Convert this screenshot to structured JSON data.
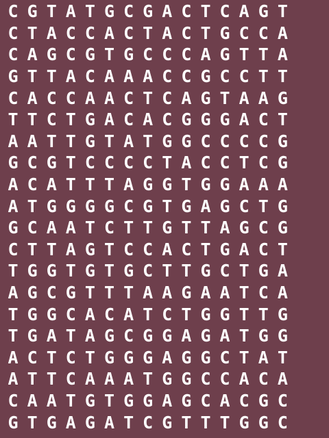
{
  "background_color": "#6e3f4c",
  "text_color": "#ffffff",
  "rows": [
    "CGTATGCGACTCAGT",
    "CTACCACTACTGCCA",
    "CAGCGTGCCCAGTTA",
    "GTTACAAACCGCCTT",
    "CACCAACTCAGTAAG",
    "TTCTGACACGGGACT",
    "AATTGTATGGCCCCG",
    "GCGTCCCCTACCTCG",
    "ACATTTAGGTGGAAA",
    "ATGGGGCGTGAGCTG",
    "GCAATCTTGTTAGCG",
    "CTTAGTCCACTGACT",
    "TGGTGTGCTTGCTGA",
    "AGCGTTTAAGAATCA",
    "TGGCACATCTGGTTG",
    "TGATAGCGGAGATGG",
    "ACTCTGGGAGGCTAT",
    "ATTCAAATGGCCACA",
    "CAATGTGGAGCACGC",
    "GTGAGATCGTTTGGC"
  ]
}
